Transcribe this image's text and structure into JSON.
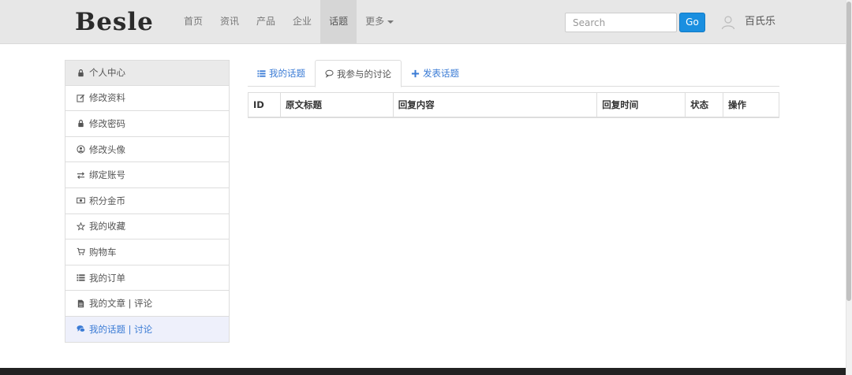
{
  "navbar": {
    "brand": "Besle",
    "links": [
      {
        "label": "首页",
        "active": false
      },
      {
        "label": "资讯",
        "active": false
      },
      {
        "label": "产品",
        "active": false
      },
      {
        "label": "企业",
        "active": false
      },
      {
        "label": "话题",
        "active": true
      },
      {
        "label": "更多",
        "active": false,
        "dropdown": true
      }
    ],
    "search": {
      "placeholder": "Search",
      "value": ""
    },
    "go_label": "Go",
    "user_name": "百氏乐"
  },
  "sidebar": {
    "items": [
      {
        "label": "个人中心",
        "icon": "lock-icon"
      },
      {
        "label": "修改资料",
        "icon": "edit-icon"
      },
      {
        "label": "修改密码",
        "icon": "lock-icon"
      },
      {
        "label": "修改头像",
        "icon": "user-circle-icon"
      },
      {
        "label": "绑定账号",
        "icon": "exchange-icon"
      },
      {
        "label": "积分金币",
        "icon": "money-icon"
      },
      {
        "label": "我的收藏",
        "icon": "star-icon"
      },
      {
        "label": "购物车",
        "icon": "cart-icon"
      },
      {
        "label": "我的订单",
        "icon": "list-icon"
      },
      {
        "label": "我的文章 | 评论",
        "icon": "file-icon"
      },
      {
        "label": "我的话题 | 讨论",
        "icon": "comments-icon",
        "active": true
      }
    ]
  },
  "tabs": [
    {
      "label": "我的话题",
      "icon": "list-icon",
      "active": false
    },
    {
      "label": "我参与的讨论",
      "icon": "comment-icon",
      "active": true
    },
    {
      "label": "发表话题",
      "icon": "plus-icon",
      "active": false
    }
  ],
  "table": {
    "columns": [
      "ID",
      "原文标题",
      "回复内容",
      "回复时间",
      "状态",
      "操作"
    ],
    "rows": []
  },
  "colors": {
    "accent": "#1a8fe0",
    "link": "#3a7bd5",
    "navbar_bg": "#e7e7e7",
    "footer_bg": "#222222",
    "active_sidebar_bg": "#eef0fb"
  }
}
